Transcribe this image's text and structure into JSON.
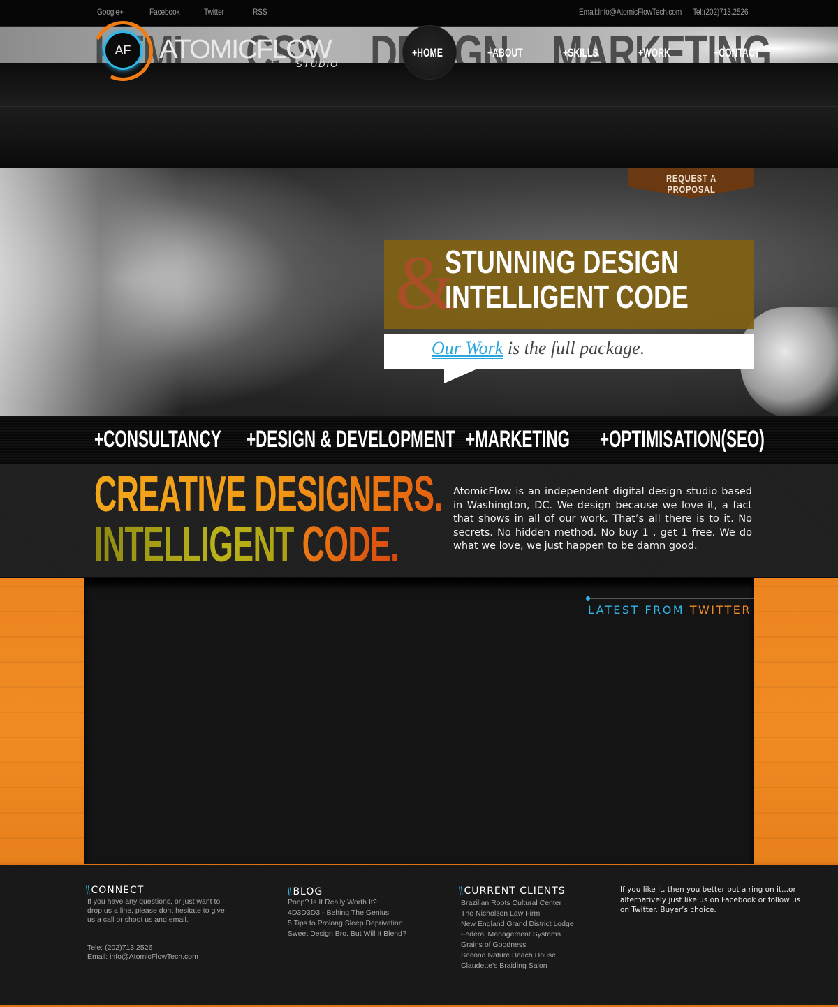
{
  "topbar": {
    "social": [
      "Google+",
      "Facebook",
      "Twitter",
      "RSS"
    ],
    "email": "Email:Info@AtomicFlowTech.com",
    "phone": "Tel:(202)713.2526"
  },
  "wordstrip": [
    "HTML",
    "CSS",
    "DESIGN",
    "MARKETING"
  ],
  "logo": {
    "badge": "AF",
    "name": "ATOMICFLOW",
    "sub": "STUDIO"
  },
  "nav": [
    "+HOME",
    "+ABOUT",
    "+SKILLS",
    "+WORK",
    "+CONTACT"
  ],
  "hero": {
    "proposal": "REQUEST A PROPOSAL",
    "amp": "&",
    "line1": "STUNNING DESIGN",
    "line2": "INTELLIGENT CODE",
    "bubble_highlight": "Our Work",
    "bubble_rest": " is the full package."
  },
  "services": [
    "+CONSULTANCY",
    "+DESIGN & DEVELOPMENT",
    "+MARKETING",
    "+OPTIMISATION(SEO)"
  ],
  "intro": {
    "line1": "CREATIVE DESIGNERS.",
    "line2a": "INTELLIGENT ",
    "line2b": "CODE.",
    "paragraph": "AtomicFlow is an independent digital design studio based in Washington, DC. We design because we love it, a fact that shows in all of our work. That’s all there is to it. No secrets. No hidden method. No buy 1 , get 1 free. We do what we love, we just happen to be damn good."
  },
  "twitter": {
    "title1": "LATEST FROM ",
    "title2": "TWITTER"
  },
  "footer": {
    "slashes": "\\\\",
    "connect": {
      "title": "CONNECT",
      "text": "If you have any questions, or just want to drop us a line, please dont hesitate to give us a call or shoot us and email.",
      "tel": "Tele: (202)713.2526",
      "email": "Email: info@AtomicFlowTech.com"
    },
    "blog": {
      "title": "BLOG",
      "items": [
        "Poop? Is It Really Worth It?",
        "4D3D3D3 - Behing The Genius",
        "5 Tips to Prolong Sleep Deprivation",
        "Sweet Design Bro. But Will It Blend?"
      ]
    },
    "clients": {
      "title": "CURRENT CLIENTS",
      "items": [
        "Brazilian Roots Cultural Center",
        "The Nicholson Law Firm",
        "New England Grand District Lodge",
        "Federal Management Systems",
        "Grains of Goodness",
        "Second Nature Beach House",
        "Claudette’s Braiding Salon"
      ]
    },
    "ring": "If you like it, then you better put a ring on it...or alternatively just like us on Facebook or follow us on Twitter. Buyer’s choice."
  },
  "colors": {
    "accent_orange": "#f08a22",
    "accent_blue": "#2fb6e8",
    "hero_box": "#816214"
  }
}
